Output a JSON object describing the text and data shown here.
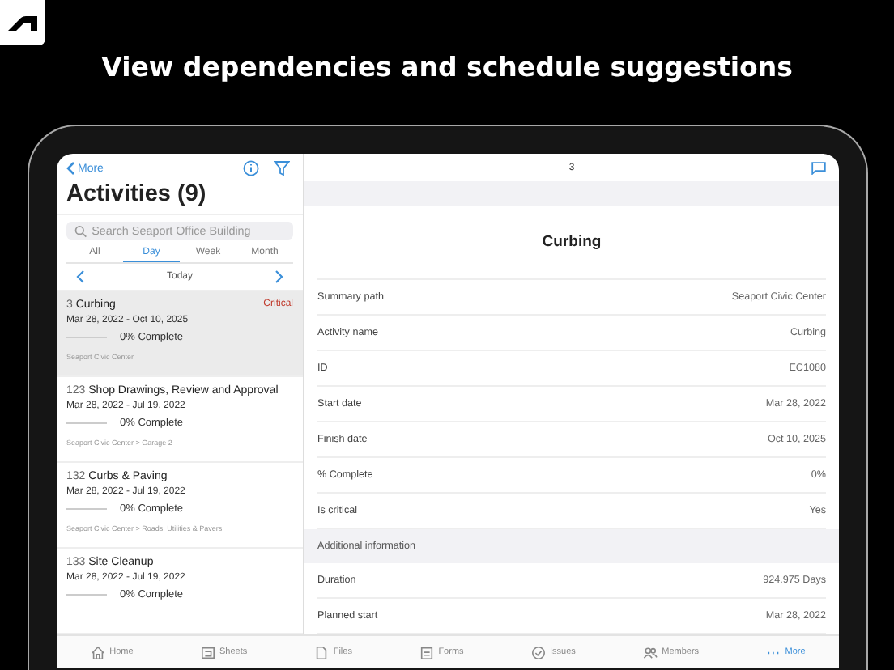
{
  "headline": "View dependencies and schedule suggestions",
  "left": {
    "back": "More",
    "title": "Activities (9)",
    "search": {
      "placeholder": "Search Seaport Office Building"
    },
    "segments": [
      {
        "label": "All",
        "selected": false
      },
      {
        "label": "Day",
        "selected": true
      },
      {
        "label": "Week",
        "selected": false
      },
      {
        "label": "Month",
        "selected": false
      }
    ],
    "period": "Today",
    "activities": [
      {
        "number": "3",
        "name": "Curbing",
        "badge": "Critical",
        "dates": "Mar 28, 2022 - Oct 10, 2025",
        "level": 0,
        "progress": "0% Complete",
        "path": "Seaport Civic Center",
        "selected": true
      },
      {
        "number": "123",
        "name": "Shop Drawings, Review and Approval",
        "dates": "Mar 28, 2022 - Jul 19, 2022",
        "level": 0,
        "progress": "0% Complete",
        "path": "Seaport Civic Center > Garage 2",
        "selected": false
      },
      {
        "number": "132",
        "name": "Curbs & Paving",
        "dates": "Mar 28, 2022 - Jul 19, 2022",
        "level": 0,
        "progress": "0% Complete",
        "path": "Seaport Civic Center > Roads, Utilities & Pavers",
        "selected": false
      },
      {
        "number": "133",
        "name": "Site Cleanup",
        "dates": "Mar 28, 2022 - Jul 19, 2022",
        "level": 0,
        "progress": "0% Complete",
        "selected": false
      }
    ]
  },
  "detail": {
    "number": "3",
    "title": "Curbing",
    "fields": [
      {
        "label": "Summary path",
        "value": "Seaport Civic Center"
      },
      {
        "label": "Activity name",
        "value": "Curbing"
      },
      {
        "label": "ID",
        "value": "EC1080"
      },
      {
        "label": "Start date",
        "value": "Mar 28, 2022"
      },
      {
        "label": "Finish date",
        "value": "Oct 10, 2025"
      },
      {
        "label": "% Complete",
        "value": "0%"
      },
      {
        "label": "Is critical",
        "value": "Yes"
      }
    ],
    "section": "Additional information",
    "more_fields": [
      {
        "label": "Duration",
        "value": "924.975 Days"
      },
      {
        "label": "Planned start",
        "value": "Mar 28, 2022"
      }
    ]
  },
  "tab_bar": [
    {
      "label": "Home",
      "selected": false
    },
    {
      "label": "Sheets",
      "selected": false
    },
    {
      "label": "Files",
      "selected": false
    },
    {
      "label": "Forms",
      "selected": false
    },
    {
      "label": "Issues",
      "selected": false
    },
    {
      "label": "Members",
      "selected": false
    },
    {
      "label": "More",
      "selected": true
    }
  ]
}
